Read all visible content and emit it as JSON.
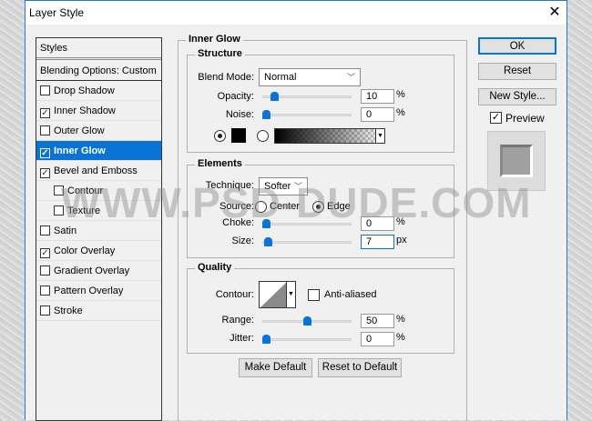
{
  "window": {
    "title": "Layer Style",
    "close_icon": "close-icon"
  },
  "sidebar": {
    "header": "Styles",
    "blending": "Blending Options: Custom",
    "items": [
      {
        "label": "Drop Shadow",
        "checked": false,
        "indent": false
      },
      {
        "label": "Inner Shadow",
        "checked": true,
        "indent": false
      },
      {
        "label": "Outer Glow",
        "checked": false,
        "indent": false
      },
      {
        "label": "Inner Glow",
        "checked": true,
        "indent": false,
        "selected": true
      },
      {
        "label": "Bevel and Emboss",
        "checked": true,
        "indent": false
      },
      {
        "label": "Contour",
        "checked": false,
        "indent": true
      },
      {
        "label": "Texture",
        "checked": false,
        "indent": true
      },
      {
        "label": "Satin",
        "checked": false,
        "indent": false
      },
      {
        "label": "Color Overlay",
        "checked": true,
        "indent": false
      },
      {
        "label": "Gradient Overlay",
        "checked": false,
        "indent": false
      },
      {
        "label": "Pattern Overlay",
        "checked": false,
        "indent": false
      },
      {
        "label": "Stroke",
        "checked": false,
        "indent": false
      }
    ]
  },
  "panel": {
    "title": "Inner Glow",
    "structure": {
      "title": "Structure",
      "blend_mode_label": "Blend Mode:",
      "blend_mode": "Normal",
      "opacity_label": "Opacity:",
      "opacity": "10",
      "opacity_unit": "%",
      "noise_label": "Noise:",
      "noise": "0",
      "noise_unit": "%",
      "color_mode": "solid",
      "color": "#000000"
    },
    "elements": {
      "title": "Elements",
      "technique_label": "Technique:",
      "technique": "Softer",
      "source_label": "Source:",
      "source_center": "Center",
      "source_edge": "Edge",
      "source": "edge",
      "choke_label": "Choke:",
      "choke": "0",
      "choke_unit": "%",
      "size_label": "Size:",
      "size": "7",
      "size_unit": "px"
    },
    "quality": {
      "title": "Quality",
      "contour_label": "Contour:",
      "anti_aliased": "Anti-aliased",
      "anti_aliased_checked": false,
      "range_label": "Range:",
      "range": "50",
      "range_unit": "%",
      "jitter_label": "Jitter:",
      "jitter": "0",
      "jitter_unit": "%"
    },
    "make_default": "Make Default",
    "reset_default": "Reset to Default"
  },
  "actions": {
    "ok": "OK",
    "reset": "Reset",
    "new_style": "New Style...",
    "preview": "Preview",
    "preview_checked": true
  },
  "watermark": "WWW.PSD-DUDE.COM",
  "colors": {
    "accent": "#0a74d6",
    "dialog_bg": "#f0f0f0"
  }
}
